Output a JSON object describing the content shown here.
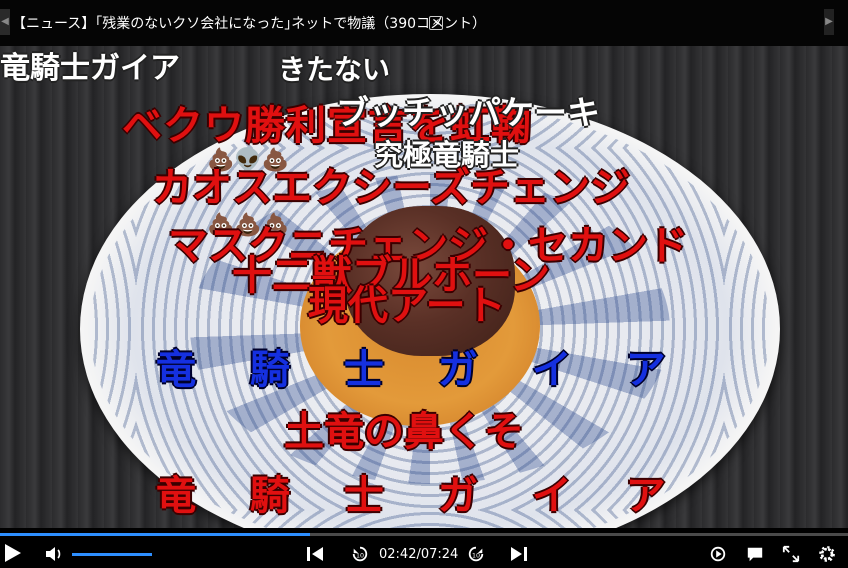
{
  "notice_bar": {
    "title": "【ニュース】｢残業のないクソ会社になった｣ネットで物議（390コメント）",
    "close_label": "×",
    "prev_arrow": "◀",
    "next_arrow": "▶"
  },
  "comments": [
    {
      "text": "竜騎士ガイア",
      "color": "white"
    },
    {
      "text": "きたない",
      "color": "white"
    },
    {
      "text": "ベクウ勝利宣言を虹鞠",
      "color": "red"
    },
    {
      "text": "ブッチッパケーキ",
      "color": "white"
    },
    {
      "text": "究極竜騎士",
      "color": "white"
    },
    {
      "text": "カオスエクシーズチェンジ",
      "color": "red"
    },
    {
      "text": "マスクニチェンジ・セカンド",
      "color": "red"
    },
    {
      "text": "十二獣ブルホーン",
      "color": "red"
    },
    {
      "text": "現代アート",
      "color": "red"
    },
    {
      "text": "竜 騎 士 ガ イ ア",
      "color": "blue"
    },
    {
      "text": "土竜の鼻くそ",
      "color": "red"
    },
    {
      "text": "竜 騎 士 ガ イ ア",
      "color": "red"
    }
  ],
  "emoji_comment": {
    "row1": "💩👽💩",
    "row2": "💩💩💩"
  },
  "player": {
    "current_time": "02:42",
    "separator": "/",
    "duration": "07:24",
    "progress_fraction": 0.365,
    "volume_fraction": 1.0,
    "icons": {
      "play": "play-icon",
      "volume": "volume-icon",
      "prev": "skip-previous-icon",
      "rewind": "rewind-10-icon",
      "forward": "forward-10-icon",
      "next": "skip-next-icon",
      "repeat": "repeat-icon",
      "comments": "comment-icon",
      "fullscreen": "fullscreen-icon",
      "settings": "settings-gear-icon"
    },
    "accent_color": "#2e8fff"
  }
}
